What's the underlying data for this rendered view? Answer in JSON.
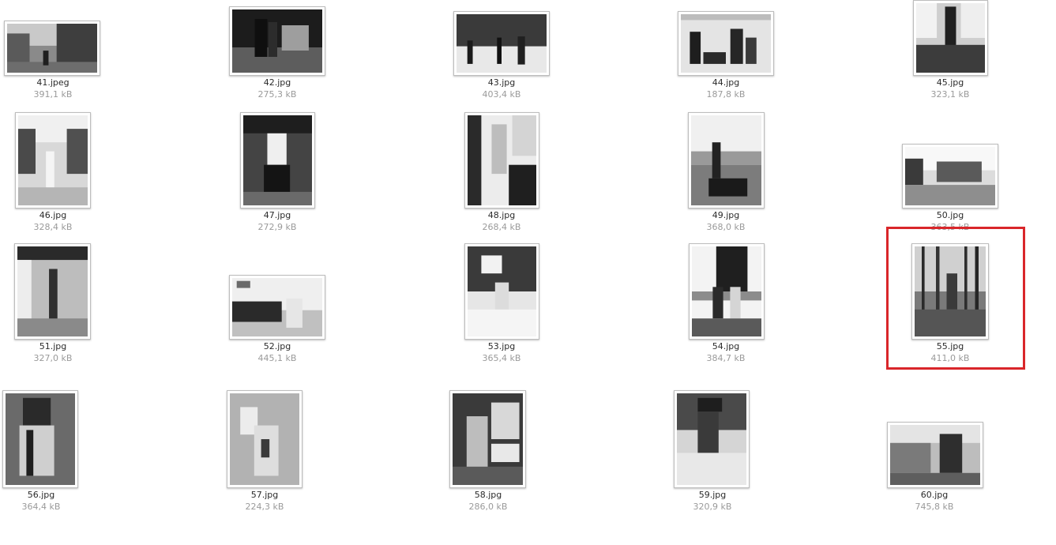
{
  "files": [
    {
      "name": "41.jpeg",
      "size": "391,1 kB"
    },
    {
      "name": "42.jpg",
      "size": "275,3 kB"
    },
    {
      "name": "43.jpg",
      "size": "403,4 kB"
    },
    {
      "name": "44.jpg",
      "size": "187,8 kB"
    },
    {
      "name": "45.jpg",
      "size": "323,1 kB"
    },
    {
      "name": "46.jpg",
      "size": "328,4 kB"
    },
    {
      "name": "47.jpg",
      "size": "272,9 kB"
    },
    {
      "name": "48.jpg",
      "size": "268,4 kB"
    },
    {
      "name": "49.jpg",
      "size": "368,0 kB"
    },
    {
      "name": "50.jpg",
      "size": "363,5 kB"
    },
    {
      "name": "51.jpg",
      "size": "327,0 kB"
    },
    {
      "name": "52.jpg",
      "size": "445,1 kB"
    },
    {
      "name": "53.jpg",
      "size": "365,4 kB"
    },
    {
      "name": "54.jpg",
      "size": "384,7 kB"
    },
    {
      "name": "55.jpg",
      "size": "411,0 kB"
    },
    {
      "name": "56.jpg",
      "size": "364,4 kB"
    },
    {
      "name": "57.jpg",
      "size": "224,3 kB"
    },
    {
      "name": "58.jpg",
      "size": "286,0 kB"
    },
    {
      "name": "59.jpg",
      "size": "320,9 kB"
    },
    {
      "name": "60.jpg",
      "size": "745,8 kB"
    }
  ],
  "colors": {
    "highlight": "#d9262a",
    "label_text": "#2b2b2b",
    "size_text": "#9a9a9a"
  }
}
